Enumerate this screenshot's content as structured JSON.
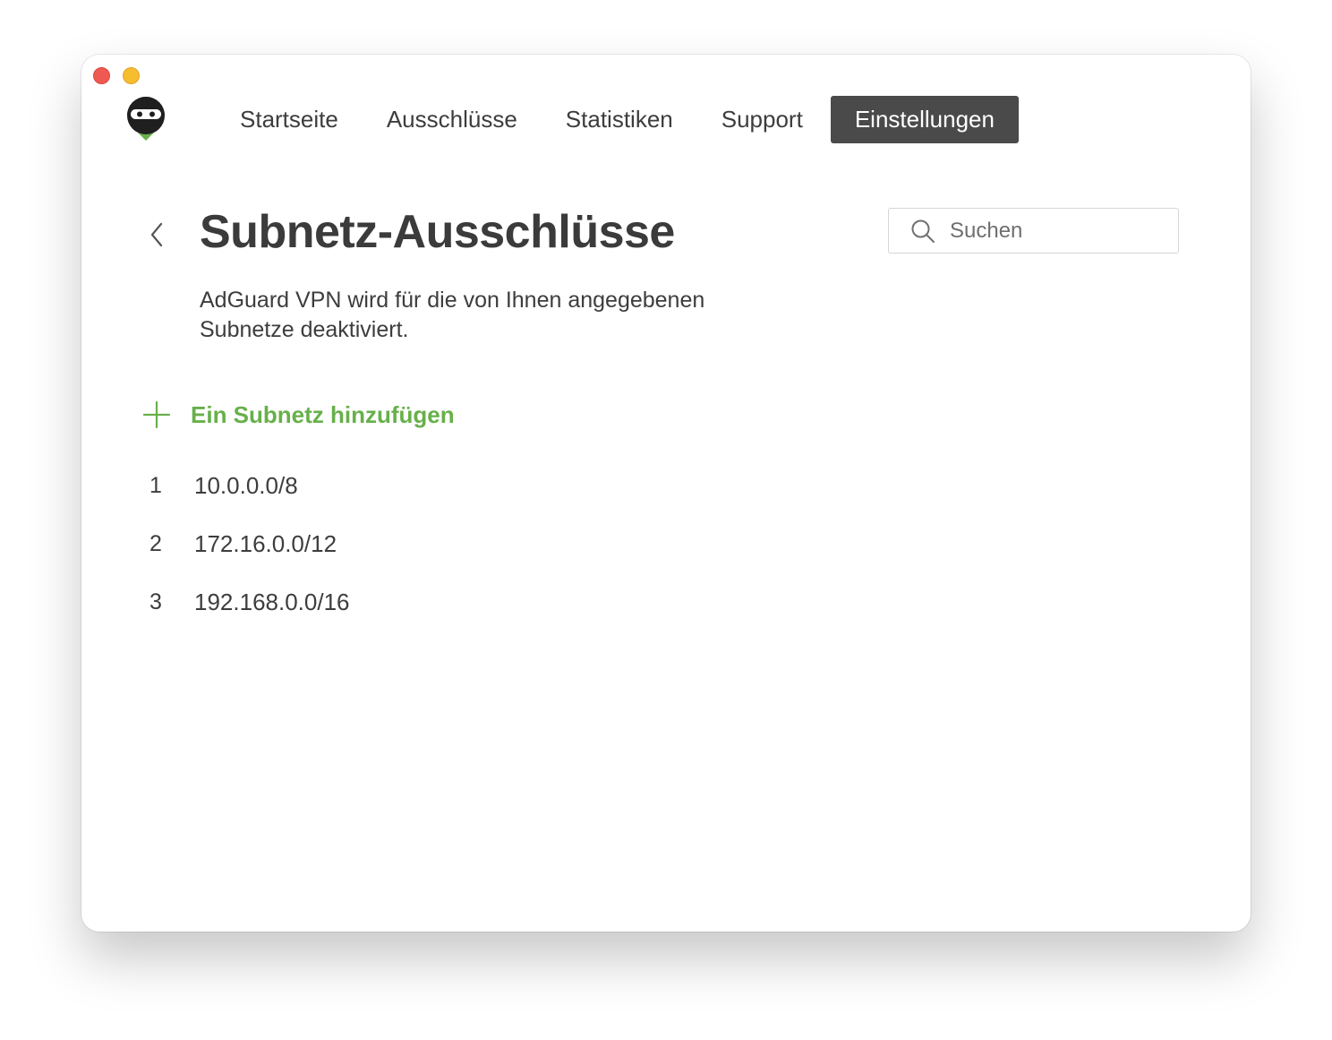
{
  "window": {
    "controls": [
      "close",
      "minimize"
    ]
  },
  "nav": {
    "items": [
      {
        "label": "Startseite"
      },
      {
        "label": "Ausschlüsse"
      },
      {
        "label": "Statistiken"
      },
      {
        "label": "Support"
      },
      {
        "label": "Einstellungen",
        "active": true
      }
    ]
  },
  "page": {
    "title": "Subnetz-Ausschlüsse",
    "description": "AdGuard VPN wird für die von Ihnen angegebenen Subnetze deaktiviert.",
    "back_icon": "chevron-left-icon"
  },
  "search": {
    "placeholder": "Suchen",
    "value": "",
    "icon": "search-icon"
  },
  "add_subnet": {
    "label": "Ein Subnetz hinzufügen",
    "icon": "plus-icon",
    "color": "#67b04a"
  },
  "subnets": [
    {
      "index": "1",
      "value": "10.0.0.0/8"
    },
    {
      "index": "2",
      "value": "172.16.0.0/12"
    },
    {
      "index": "3",
      "value": "192.168.0.0/16"
    }
  ],
  "colors": {
    "accent": "#67b04a",
    "active_tab_bg": "#4a4a4a",
    "text": "#3d3d3d",
    "close": "#ee5a52",
    "minimize": "#f6bd2f"
  }
}
